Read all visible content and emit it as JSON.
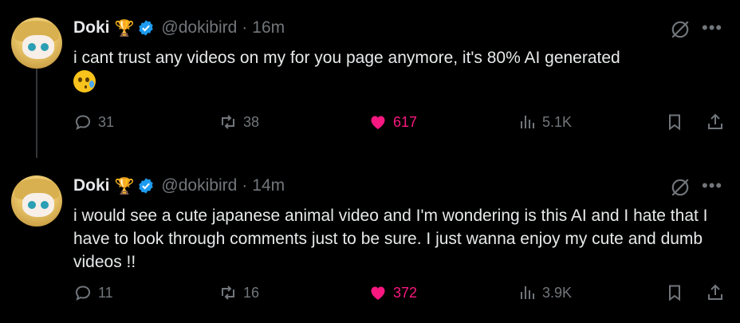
{
  "tweets": [
    {
      "author": {
        "name": "Doki",
        "handle": "@dokibird",
        "badge": "trophy-icon"
      },
      "time": "16m",
      "text": "i cant trust any videos on my for you page anymore, it's 80% AI generated",
      "emoji": "face-holding-back-tears-icon",
      "stats": {
        "replies": "31",
        "reposts": "38",
        "likes": "617",
        "views": "5.1K"
      }
    },
    {
      "author": {
        "name": "Doki",
        "handle": "@dokibird",
        "badge": "trophy-icon"
      },
      "time": "14m",
      "text": "i would see a cute japanese animal video and I'm wondering is this AI and I hate that I have to look through comments just to be sure. I just wanna enjoy my cute and dumb videos !!",
      "stats": {
        "replies": "11",
        "reposts": "16",
        "likes": "372",
        "views": "3.9K"
      }
    }
  ],
  "colors": {
    "background": "#000000",
    "text": "#e7e9ea",
    "muted": "#71767b",
    "like": "#f91880",
    "verified": "#1d9bf0"
  },
  "separator": "·"
}
